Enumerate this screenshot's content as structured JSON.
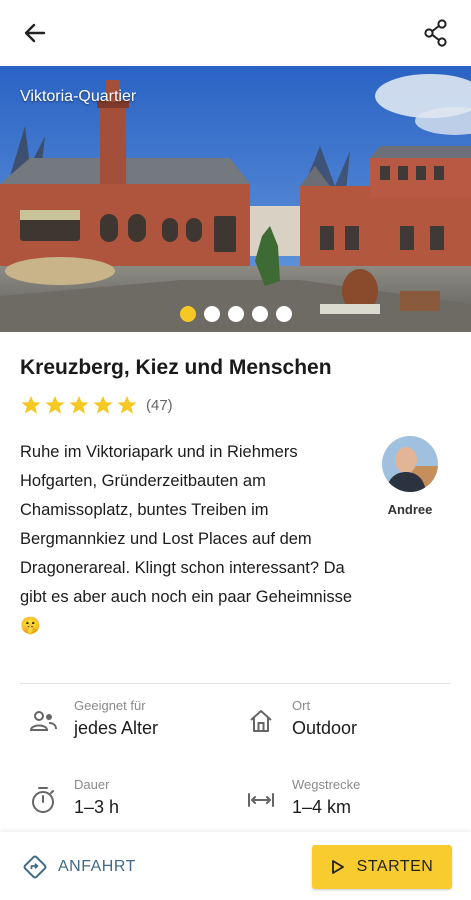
{
  "header": {
    "back_icon": "arrow-left-icon",
    "share_icon": "share-icon"
  },
  "hero": {
    "caption": "Viktoria-Quartier",
    "slide_count": 5,
    "active_slide": 1
  },
  "tour": {
    "title": "Kreuzberg, Kiez und Menschen",
    "rating_stars": 5,
    "rating_count": "(47)",
    "description": "Ruhe im Viktoriapark und in Riehmers Hofgarten, Gründerzeitbauten am Chamissoplatz, buntes Treiben im Bergmannkiez und Lost Places auf dem Dragonerareal. Klingt schon interessant? Da gibt es aber auch noch ein paar Geheimnisse 🤫",
    "author": "Andree"
  },
  "info": {
    "suitable_label": "Geeignet für",
    "suitable_value": "jedes Alter",
    "place_label": "Ort",
    "place_value": "Outdoor",
    "duration_label": "Dauer",
    "duration_value": "1–3 h",
    "distance_label": "Wegstrecke",
    "distance_value": "1–4 km"
  },
  "actions": {
    "directions_label": "ANFAHRT",
    "start_label": "STARTEN"
  },
  "colors": {
    "accent": "#f8cc2e",
    "star": "#f5c824",
    "link": "#3f6b86"
  }
}
